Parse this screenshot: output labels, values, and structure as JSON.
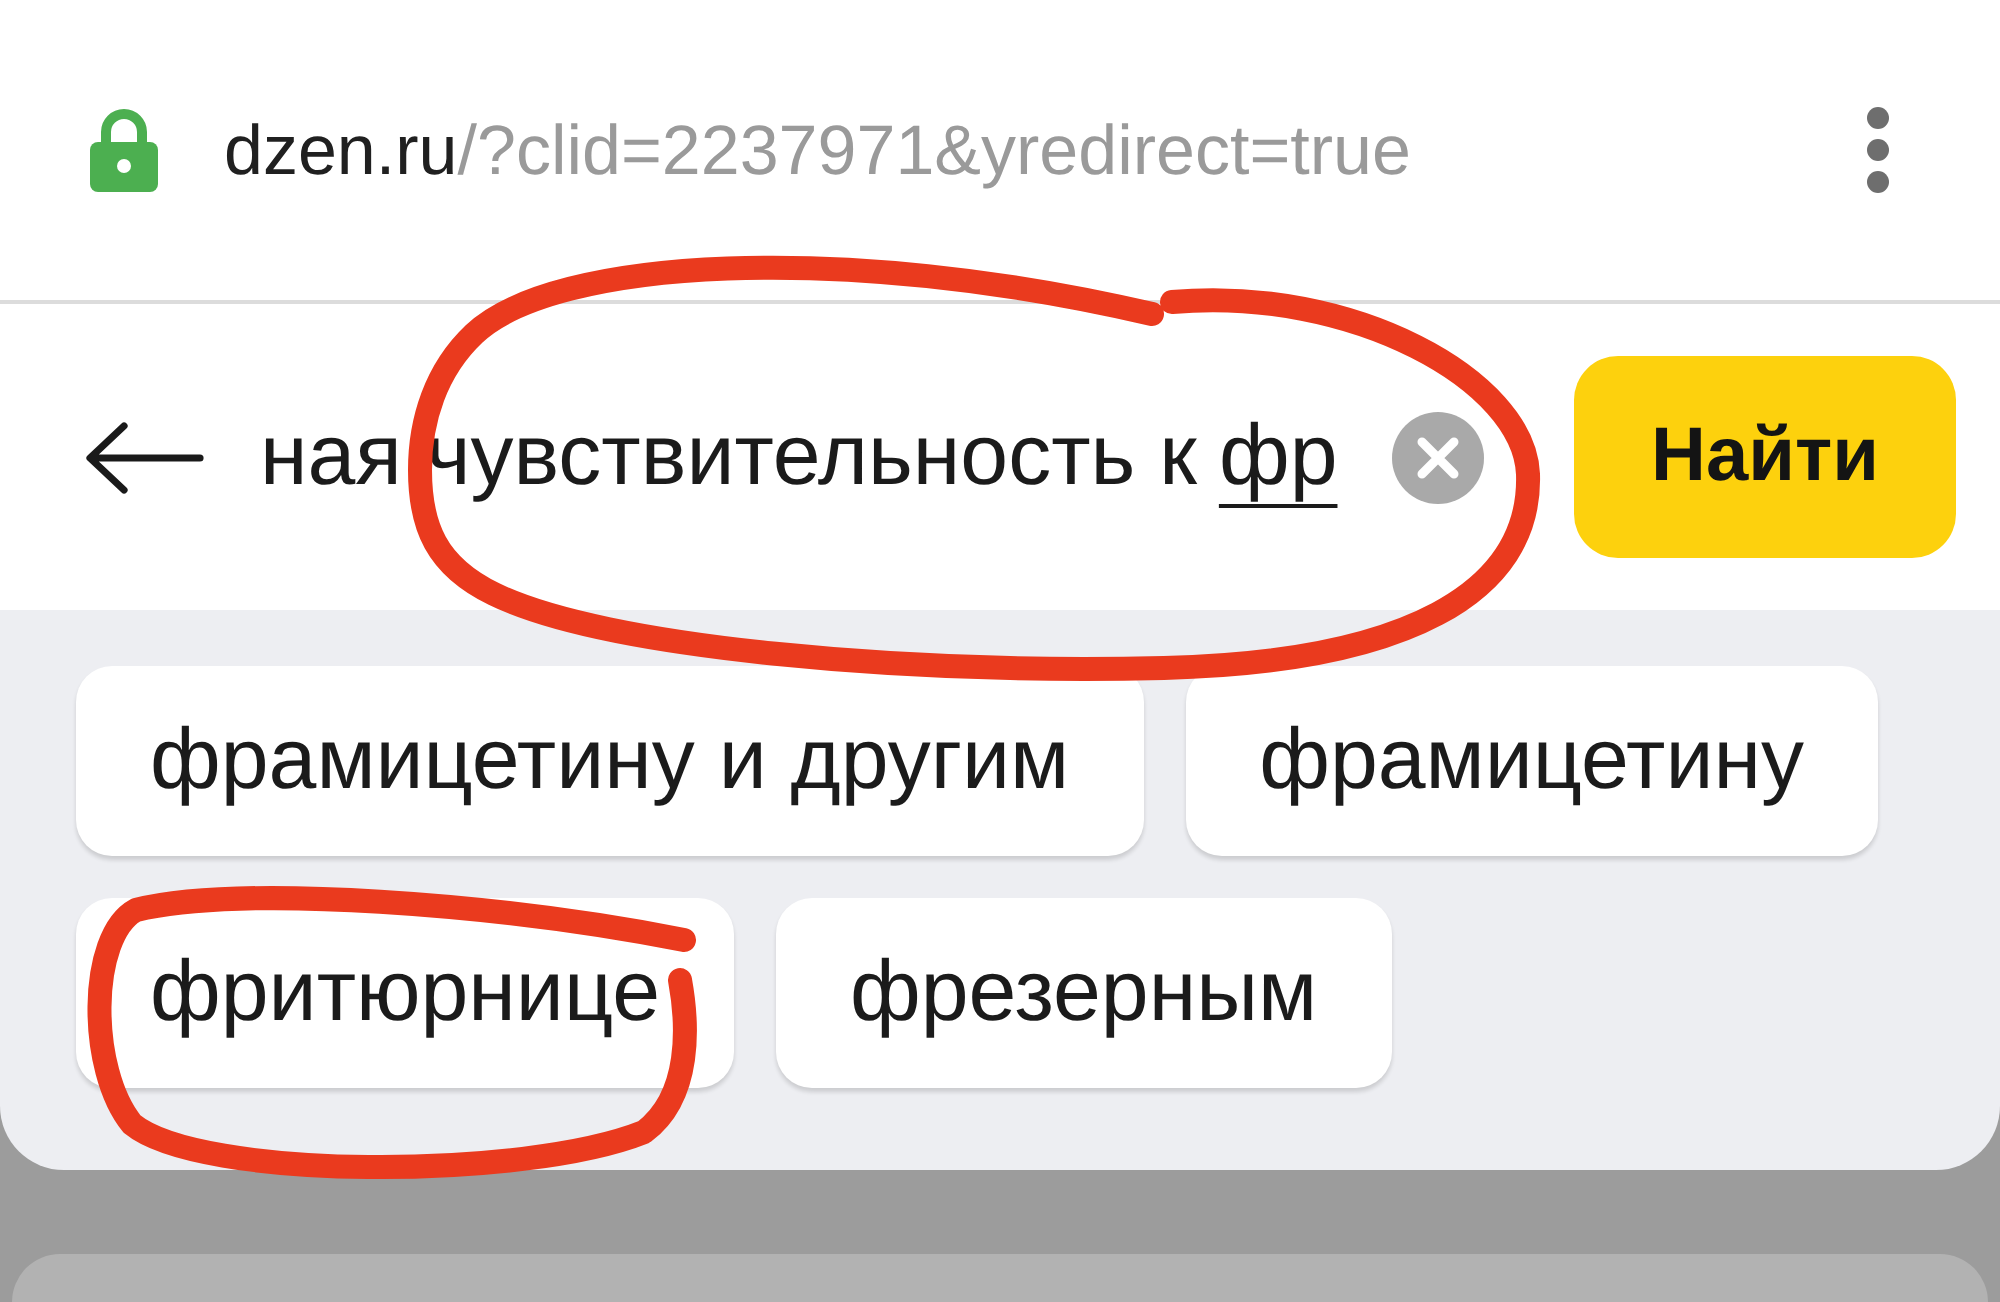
{
  "address_bar": {
    "secure": true,
    "domain": "dzen.ru",
    "path": "/?clid=2237971&yredirect=true"
  },
  "search": {
    "value": "ная чувствительность к",
    "composing": "фр",
    "circled": true,
    "submit_label": "Найти"
  },
  "suggestions": [
    {
      "label": "фрамицетину и другим",
      "circled": false
    },
    {
      "label": "фрамицетину",
      "circled": false
    },
    {
      "label": "фритюрнице",
      "circled": true
    },
    {
      "label": "фрезерным",
      "circled": false
    }
  ]
}
